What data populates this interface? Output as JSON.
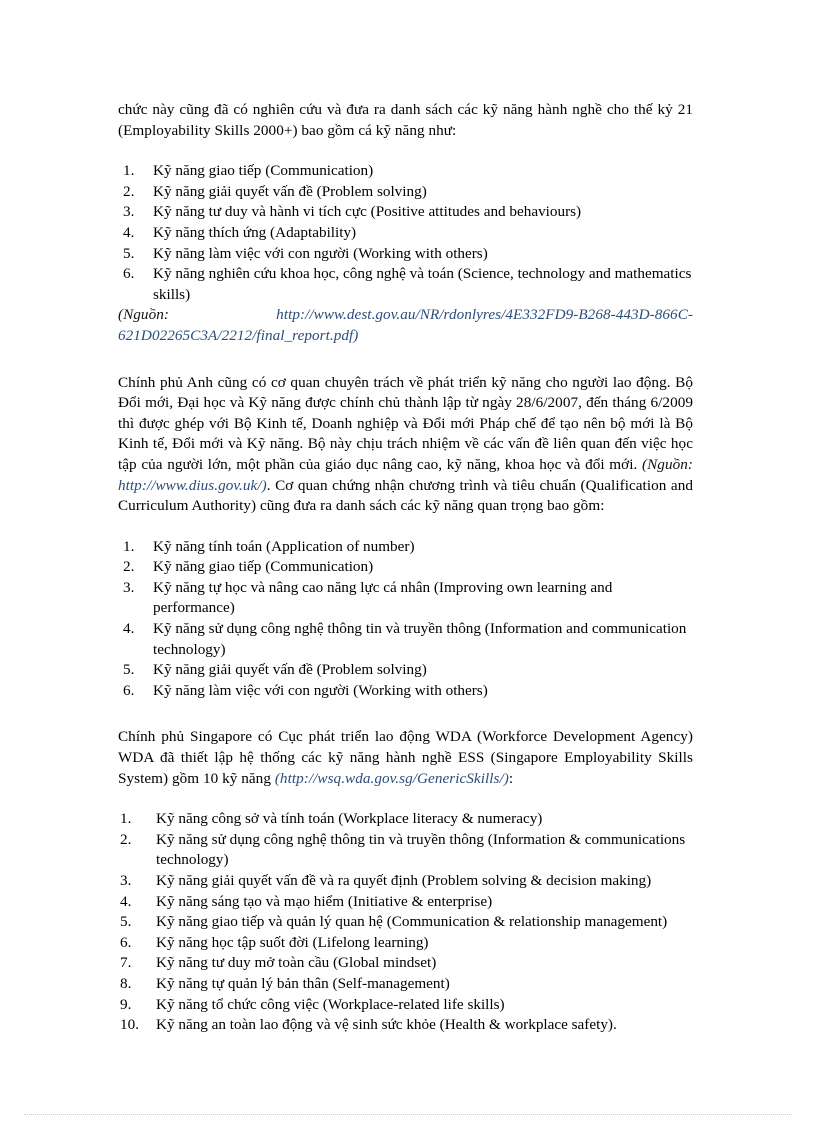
{
  "document": {
    "paragraph_1": "chức này cũng đã có nghiên  cứu và đưa ra danh sách các kỹ năng hành nghề  cho thế kỷ 21 (Employability   Skills  2000+) bao gồm cá kỹ năng  như:",
    "list_1": [
      {
        "num": "1.",
        "text": "Kỹ năng giao tiếp (Communication)"
      },
      {
        "num": "2.",
        "text": "Kỹ năng giải  quyết vấn đề (Problem  solving)"
      },
      {
        "num": "3.",
        "text": "Kỹ năng tư duy và hành vi tích cực (Positive  attitudes  and behaviours)"
      },
      {
        "num": "4.",
        "text": "Kỹ năng thích  ứng (Adaptability)"
      },
      {
        "num": "5.",
        "text": "Kỹ năng làm việc với con người (Working  with  others)"
      },
      {
        "num": "6.",
        "text": "Kỹ năng nghiên  cứu khoa học, công nghệ và toán (Science,  technology  and mathematics   skills)"
      }
    ],
    "source_1": {
      "label": "(Nguồn: ",
      "url": "http://www.dest.gov.au/NR/rdonlyres/4E332FD9-B268-443D-866C-621D02265C3A/2212/final_report.pdf)"
    },
    "paragraph_2_part1": "Chính phủ Anh cũng có cơ quan chuyên  trách về phát triển  kỹ năng cho người lao động. Bộ Đổi mới, Đại học và Kỹ năng được chính  chủ thành lập từ ngày 28/6/2007, đến tháng 6/2009 thì được ghép với Bộ Kinh tế, Doanh nghiệp  và Đổi mới Pháp chế để tạo nên bộ mới là Bộ Kinh tế, Đổi mới và Kỹ năng. Bộ này chịu trách nhiệm  về các vấn đề liên  quan đến việc học tập của người lớn, một phần của giáo dục nâng cao, kỹ năng, khoa học và đổi mới.  ",
    "source_2": {
      "label": "(Nguồn: ",
      "url": "http://www.dius.gov.uk/)"
    },
    "paragraph_2_part2": ". Cơ quan chứng nhận chương trình  và tiêu chuẩn (Qualification   and Curriculum   Authority)  cũng đưa ra danh sách các kỹ năng  quan trọng bao gồm:",
    "list_2": [
      {
        "num": "1.",
        "text": "Kỹ năng tính  toán (Application   of number)"
      },
      {
        "num": "2.",
        "text": "Kỹ năng giao tiếp (Communication)"
      },
      {
        "num": "3.",
        "text": "Kỹ năng tự học và nâng cao năng lực cá nhân (Improving   own learning  and performance)"
      },
      {
        "num": "4.",
        "text": "Kỹ năng sử dụng công nghệ thông tin và truyền  thông (Information  and communication   technology)"
      },
      {
        "num": "5.",
        "text": "Kỹ năng giải  quyết vấn đề (Problem  solving)"
      },
      {
        "num": "6.",
        "text": "Kỹ năng làm việc với con người (Working  with  others)"
      }
    ],
    "paragraph_3_part1": "Chính phủ Singapore  có Cục phát triển  lao động WDA (Workforce  Development  Agency)  WDA đã thiết  lập hệ thống  các kỹ năng hành nghề  ESS (Singapore  Employability   Skills  System) gồm 10 kỹ năng ",
    "source_3": {
      "url": "(http://wsq.wda.gov.sg/GenericSkills/)"
    },
    "paragraph_3_part2": ":",
    "list_3": [
      {
        "num": "1.",
        "text": "Kỹ năng công sở và tính toán (Workplace literacy  & numeracy)"
      },
      {
        "num": "2.",
        "text": "Kỹ năng sử dụng công nghệ thông tin và truyền  thông (Information  & communications   technology)"
      },
      {
        "num": "3.",
        "text": "Kỹ năng giải  quyết vấn đề và ra quyết định  (Problem  solving  & decision  making)"
      },
      {
        "num": "4.",
        "text": "Kỹ năng sáng tạo và mạo hiểm (Initiative   & enterprise)"
      },
      {
        "num": "5.",
        "text": "Kỹ năng giao tiếp và quản lý quan hệ (Communication   & relationship  management)"
      },
      {
        "num": "6.",
        "text": "Kỹ năng học tập suốt đời (Lifelong  learning)"
      },
      {
        "num": "7.",
        "text": "Kỹ năng tư duy mở toàn cầu (Global  mindset)"
      },
      {
        "num": "8.",
        "text": "Kỹ năng tự quản lý bản thân (Self-management)"
      },
      {
        "num": "9.",
        "text": "Kỹ năng tổ chức công việc (Workplace-related  life  skills)"
      },
      {
        "num": "10.",
        "text": "Kỹ năng an toàn lao động và vệ sinh sức khỏe (Health  & workplace  safety)."
      }
    ]
  },
  "colors": {
    "text": "#000000",
    "link": "#2a4d7a",
    "footer_rule": "#b9c6cf"
  }
}
